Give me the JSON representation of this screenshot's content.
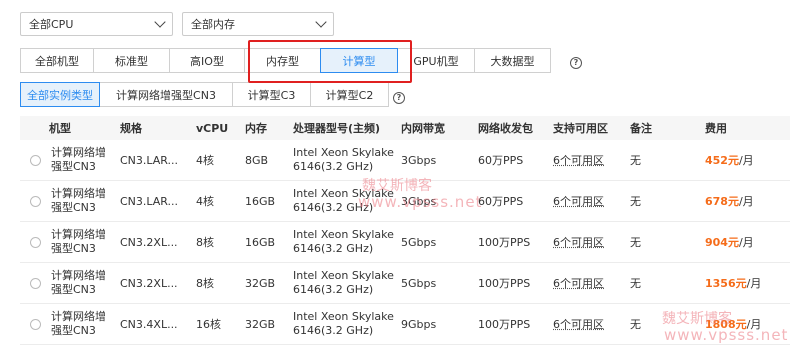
{
  "filters": {
    "cpu_select": "全部CPU",
    "memory_select": "全部内存"
  },
  "type_tabs": [
    "全部机型",
    "标准型",
    "高IO型",
    "内存型",
    "计算型",
    "GPU机型",
    "大数据型"
  ],
  "type_tabs_active": "计算型",
  "instance_tabs": [
    "全部实例类型",
    "计算网络增强型CN3",
    "计算型C3",
    "计算型C2"
  ],
  "instance_tabs_active": "全部实例类型",
  "help_glyph": "?",
  "table": {
    "headers": [
      "机型",
      "规格",
      "vCPU",
      "内存",
      "处理器型号(主频)",
      "内网带宽",
      "网络收发包",
      "支持可用区",
      "备注",
      "费用"
    ],
    "rows": [
      {
        "model": "计算网络增强型CN3",
        "spec": "CN3.LAR...",
        "vcpu": "4核",
        "mem": "8GB",
        "cpu_line1": "Intel Xeon Skylake",
        "cpu_line2": "6146(3.2 GHz)",
        "bandwidth": "3Gbps",
        "pps": "60万PPS",
        "zones": "6个可用区",
        "note": "无",
        "price": "452元",
        "unit": "/月"
      },
      {
        "model": "计算网络增强型CN3",
        "spec": "CN3.LAR...",
        "vcpu": "4核",
        "mem": "16GB",
        "cpu_line1": "Intel Xeon Skylake",
        "cpu_line2": "6146(3.2 GHz)",
        "bandwidth": "3Gbps",
        "pps": "60万PPS",
        "zones": "6个可用区",
        "note": "无",
        "price": "678元",
        "unit": "/月"
      },
      {
        "model": "计算网络增强型CN3",
        "spec": "CN3.2XL...",
        "vcpu": "8核",
        "mem": "16GB",
        "cpu_line1": "Intel Xeon Skylake",
        "cpu_line2": "6146(3.2 GHz)",
        "bandwidth": "5Gbps",
        "pps": "100万PPS",
        "zones": "6个可用区",
        "note": "无",
        "price": "904元",
        "unit": "/月"
      },
      {
        "model": "计算网络增强型CN3",
        "spec": "CN3.2XL...",
        "vcpu": "8核",
        "mem": "32GB",
        "cpu_line1": "Intel Xeon Skylake",
        "cpu_line2": "6146(3.2 GHz)",
        "bandwidth": "5Gbps",
        "pps": "100万PPS",
        "zones": "6个可用区",
        "note": "无",
        "price": "1356元",
        "unit": "/月"
      },
      {
        "model": "计算网络增强型CN3",
        "spec": "CN3.4XL...",
        "vcpu": "16核",
        "mem": "32GB",
        "cpu_line1": "Intel Xeon Skylake",
        "cpu_line2": "6146(3.2 GHz)",
        "bandwidth": "9Gbps",
        "pps": "100万PPS",
        "zones": "6个可用区",
        "note": "无",
        "price": "1808元",
        "unit": "/月"
      }
    ]
  },
  "watermarks": [
    "魏艾斯博客",
    "www.vpsss.net",
    "魏艾斯博客",
    "www.vpsss.net"
  ],
  "colors": {
    "accent": "#2d8cf0",
    "price": "#f56c1a",
    "highlight": "#e02020"
  }
}
